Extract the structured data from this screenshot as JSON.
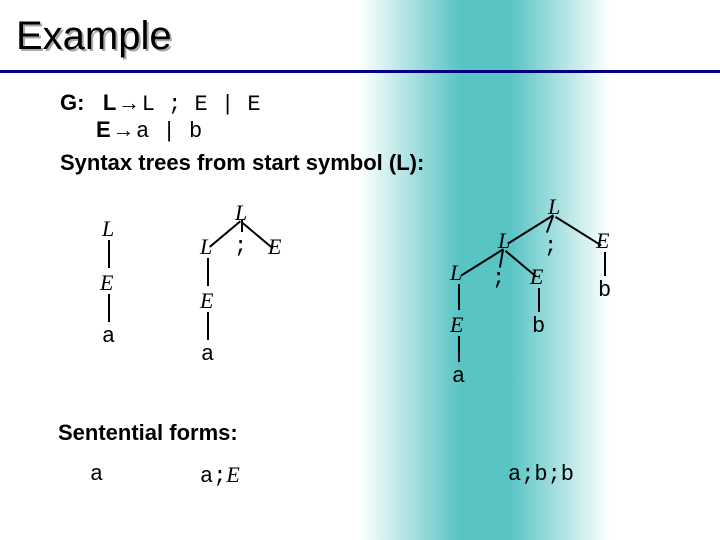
{
  "title": "Example",
  "grammar": {
    "prefix": "G:",
    "line1_lhs": "L",
    "line1_arrow": "→",
    "line1_rhs": "L ; E | E",
    "line2_lhs": "E",
    "line2_arrow": "→",
    "line2_rhs": "a | b"
  },
  "syntax_label": "Syntax trees from start symbol (L):",
  "tree1": {
    "L": "L",
    "E": "E",
    "a": "a"
  },
  "tree2": {
    "Lroot": "L",
    "Lleft": "L",
    "semi": ";",
    "Eright": "E",
    "Eleft": "E",
    "a": "a"
  },
  "tree3": {
    "Lroot": "L",
    "L2": "L",
    "semi1": ";",
    "E1": "E",
    "L3": "L",
    "semi2": ";",
    "E2": "E",
    "b1": "b",
    "E3": "E",
    "b2": "b",
    "a": "a"
  },
  "sentential_label": "Sentential forms:",
  "sform1": "a",
  "sform2_a": "a;",
  "sform2_E": "E",
  "sform3": "a;b;b"
}
